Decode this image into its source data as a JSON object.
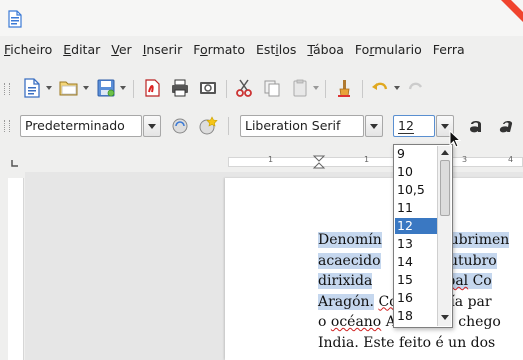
{
  "menubar": {
    "items": [
      {
        "acc": "F",
        "rest": "icheiro"
      },
      {
        "acc": "E",
        "rest": "ditar"
      },
      {
        "acc": "V",
        "rest": "er"
      },
      {
        "acc": "I",
        "rest": "nserir"
      },
      {
        "pre": "F",
        "acc": "o",
        "rest": "rmato"
      },
      {
        "pre": "Est",
        "acc": "i",
        "rest": "los"
      },
      {
        "acc": "T",
        "rest": "áboa"
      },
      {
        "pre": "Fo",
        "acc": "r",
        "rest": "mulario"
      },
      {
        "pre": "Ferra",
        "acc": "",
        "rest": ""
      }
    ]
  },
  "toolbar2": {
    "paragraph_style": "Predeterminado",
    "font_name": "Liberation Serif",
    "font_size": "12"
  },
  "ruler": {
    "numbers": [
      "1",
      "1",
      "3",
      "4"
    ]
  },
  "font_size_list": {
    "options": [
      "9",
      "10",
      "10,5",
      "11",
      "12",
      "13",
      "14",
      "15",
      "16",
      "18"
    ],
    "selected": "12"
  },
  "document": {
    "line1": {
      "a": "Denomín",
      "b": "cubrimen"
    },
    "line2": {
      "a": "acaecido",
      "b": "outubro"
    },
    "line3": {
      "a": "dirixida",
      "b": "tóbal",
      "c": "Co"
    },
    "line4": {
      "a": "Aragón.",
      "b": "Colón",
      "c": "había par"
    },
    "line5": {
      "a": "o ",
      "b": "océano",
      "c": "Atlántico, chego"
    },
    "line6": {
      "a": "India. Este feito é un dos"
    }
  },
  "colors": {
    "selection": "#3a78c2",
    "text_highlight": "#c5d7ee",
    "spellcheck": "#d02020"
  }
}
